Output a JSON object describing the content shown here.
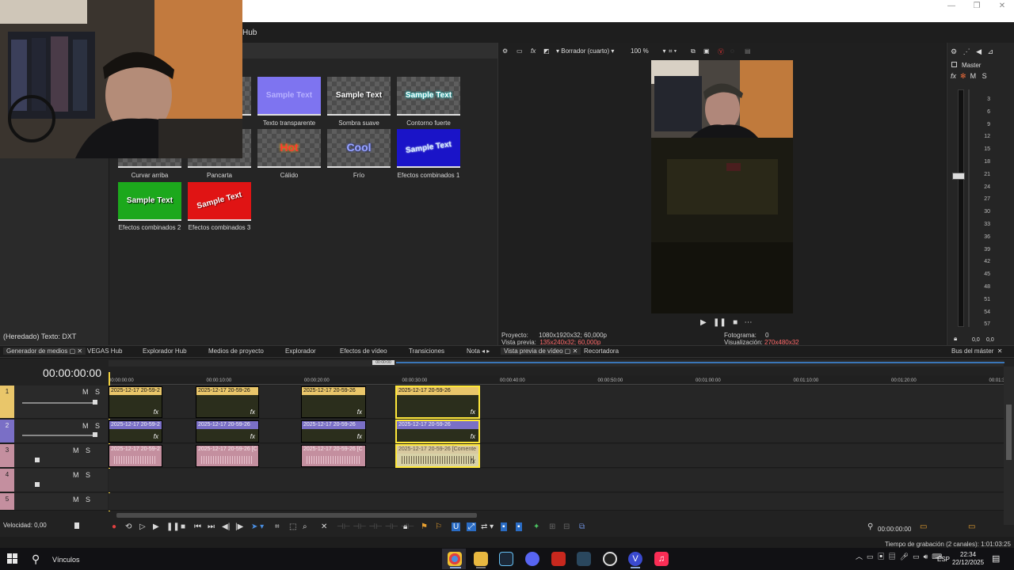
{
  "menu": {
    "hub_label": "Hub"
  },
  "colors": {
    "accent": "#3a76b8",
    "selection": "#ffe83a",
    "video_clip": "#e9c66a",
    "video2_clip": "#7a6fc6",
    "audio_clip": "#c48f9f",
    "record": "#e04040"
  },
  "presets": [
    {
      "label": "Texto transparente",
      "sample": "Sample Text",
      "bg": "#7e74f0",
      "fg": "#b7b1ff"
    },
    {
      "label": "Sombra suave",
      "sample": "Sample Text",
      "fg": "#ffffff"
    },
    {
      "label": "Contorno fuerte",
      "sample": "Sample Text",
      "fg": "#ffffff"
    },
    {
      "label": "Curvar arriba",
      "sample": ""
    },
    {
      "label": "Pancarta",
      "sample": ""
    },
    {
      "label": "Cálido",
      "sample": "Hot",
      "fg": "#ff3b2f"
    },
    {
      "label": "Frío",
      "sample": "Cool",
      "fg": "#9aa6ff"
    },
    {
      "label": "Efectos combinados 1",
      "sample": "Sample Text",
      "bg": "#1a14c8",
      "fg": "#cfe8ff"
    },
    {
      "label": "Efectos combinados 2",
      "sample": "Sample Text",
      "bg": "#1ca81c",
      "fg": "#ffffff"
    },
    {
      "label": "Efectos combinados 3",
      "sample": "Sample Text",
      "bg": "#e01414",
      "fg": "#ffffff"
    }
  ],
  "inherited_text": "(Heredado) Texto: DXT",
  "preview": {
    "mode": "Borrador (cuarto)",
    "zoom": "100 %",
    "project_label": "Proyecto:",
    "project_value": "1080x1920x32; 60,000p",
    "preview_label": "Vista previa:",
    "preview_value": "135x240x32; 60,000p",
    "frame_label": "Fotograma:",
    "frame_value": "0",
    "display_label": "Visualización:",
    "display_value": "270x480x32"
  },
  "master": {
    "label": "Master",
    "m": "M",
    "s": "S",
    "ticks": [
      "3",
      "6",
      "9",
      "12",
      "15",
      "18",
      "21",
      "24",
      "27",
      "30",
      "33",
      "36",
      "39",
      "42",
      "45",
      "48",
      "51",
      "54",
      "57"
    ],
    "bottom_left": "0,0",
    "bottom_right": "0,0"
  },
  "tabs": {
    "generator": "Generador de medios",
    "vegas_hub": "VEGAS Hub",
    "explorer_hub": "Explorador Hub",
    "project_media": "Medios de proyecto",
    "explorer": "Explorador",
    "video_fx": "Efectos de vídeo",
    "transitions": "Transiciones",
    "notes": "Nota",
    "video_preview": "Vista previa de vídeo",
    "trimmer": "Recortadora",
    "master_bus": "Bus del máster"
  },
  "timeline": {
    "timecode": "00:00:00:00",
    "loop_marker": "00:00:00",
    "ruler": [
      "00:00:00:00",
      "00:00:10:00",
      "00:00:20:00",
      "00:00:30:00",
      "00:00:40:00",
      "00:00:50:00",
      "00:01:00:00",
      "00:01:10:00",
      "00:01:20:00",
      "00:01:3"
    ],
    "tracks": [
      {
        "num": "1",
        "m": "M",
        "s": "S"
      },
      {
        "num": "2",
        "m": "M",
        "s": "S"
      },
      {
        "num": "3",
        "m": "M",
        "s": "S"
      },
      {
        "num": "4",
        "m": "M",
        "s": "S"
      },
      {
        "num": "5",
        "m": "M",
        "s": "S"
      }
    ],
    "video_clips": [
      "2025-12-17 20-59-2",
      "2025-12-17 20-59-26",
      "2025-12-17 20-59-26",
      "2025-12-17 20-59-26"
    ],
    "video2_clips": [
      "2025-12-17 20-59-2",
      "2025-12-17 20-59-26",
      "2025-12-17 20-59-26",
      "2025-12-17 20-59-26"
    ],
    "audio_clips": [
      "2025-12-17 20-59-2",
      "2025-12-17 20-59-26 [C",
      "2025-12-17 20-59-26 [C",
      "2025-12-17 20-59-26 [Comente"
    ],
    "fx": "fx",
    "speed": "Velocidad: 0,00",
    "cursor_time": "00:00:00:00"
  },
  "status": {
    "rec_time": "Tiempo de grabación (2 canales): 1:01:03:25"
  },
  "taskbar": {
    "search": "Vínculos",
    "lang": "ESP",
    "time": "22:34",
    "date": "22/12/2025"
  }
}
